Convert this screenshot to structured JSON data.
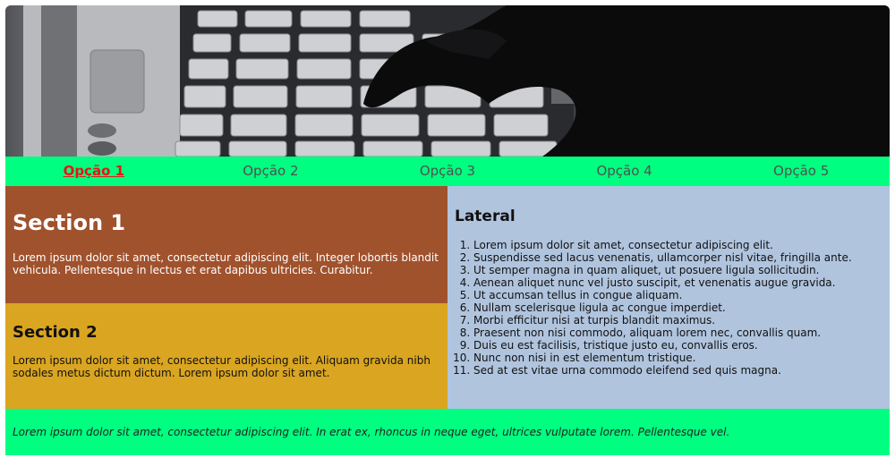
{
  "nav": {
    "items": [
      {
        "label": "Opção 1",
        "active": true
      },
      {
        "label": "Opção 2"
      },
      {
        "label": "Opção 3"
      },
      {
        "label": "Opção 4"
      },
      {
        "label": "Opção 5"
      }
    ]
  },
  "section1": {
    "title": "Section 1",
    "text": "Lorem ipsum dolor sit amet, consectetur adipiscing elit. Integer lobortis blandit vehicula. Pellentesque in lectus et erat dapibus ultricies. Curabitur."
  },
  "section2": {
    "title": "Section 2",
    "text": "Lorem ipsum dolor sit amet, consectetur adipiscing elit. Aliquam gravida nibh sodales metus dictum dictum. Lorem ipsum dolor sit amet."
  },
  "lateral": {
    "title": "Lateral",
    "items": [
      "Lorem ipsum dolor sit amet, consectetur adipiscing elit.",
      "Suspendisse sed lacus venenatis, ullamcorper nisl vitae, fringilla ante.",
      "Ut semper magna in quam aliquet, ut posuere ligula sollicitudin.",
      "Aenean aliquet nunc vel justo suscipit, et venenatis augue gravida.",
      "Ut accumsan tellus in congue aliquam.",
      "Nullam scelerisque ligula ac congue imperdiet.",
      "Morbi efficitur nisi at turpis blandit maximus.",
      "Praesent non nisi commodo, aliquam lorem nec, convallis quam.",
      "Duis eu est facilisis, tristique justo eu, convallis eros.",
      "Nunc non nisi in est elementum tristique.",
      "Sed at est vitae urna commodo eleifend sed quis magna."
    ]
  },
  "footer": {
    "text": "Lorem ipsum dolor sit amet, consectetur adipiscing elit. In erat ex, rhoncus in neque eget, ultrices vulputate lorem. Pellentesque vel."
  },
  "colors": {
    "nav_bg": "#00ff80",
    "nav_active": "#ee1111",
    "section1_bg": "#a0522d",
    "section2_bg": "#daa520",
    "lateral_bg": "#b0c4de",
    "footer_bg": "#00ff80"
  },
  "hero": {
    "icon": "laptop-keyboard-hand-photo"
  }
}
